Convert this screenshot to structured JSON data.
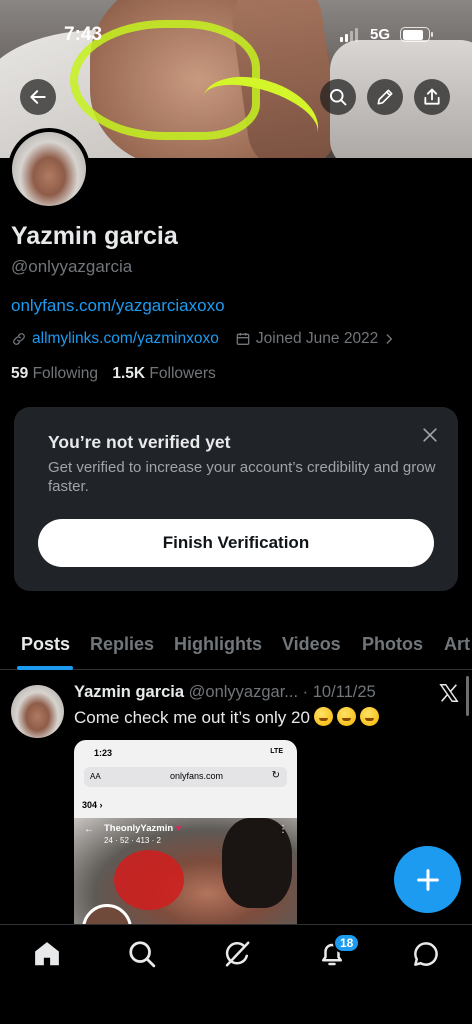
{
  "status_bar": {
    "time": "7:43",
    "network": "5G"
  },
  "profile": {
    "name": "Yazmin garcia",
    "handle": "@onlyyazgarcia",
    "bio_link": "onlyfans.com/yazgarciaxoxo",
    "website": "allmylinks.com/yazminxoxo",
    "joined": "Joined June 2022",
    "following_count": "59",
    "following_label": "Following",
    "followers_count": "1.5K",
    "followers_label": "Followers"
  },
  "verification_card": {
    "title": "You’re not verified yet",
    "description": "Get verified to increase your account’s credibility and grow faster.",
    "button_label": "Finish Verification"
  },
  "tabs": [
    "Posts",
    "Replies",
    "Highlights",
    "Videos",
    "Photos",
    "Art"
  ],
  "active_tab": "Posts",
  "post": {
    "author": "Yazmin garcia",
    "handle": "@onlyyazgar...",
    "date": "· 10/11/25",
    "text": "Come check me out it’s only 20",
    "media": {
      "time": "1:23",
      "status": "LTE",
      "aa": "AA",
      "url": "onlyfans.com",
      "count": "304 ›",
      "profile_name": "TheonlyYazmin",
      "stats": "24 · 52 · 413 · 2"
    }
  },
  "bottom_nav": {
    "items": [
      "home-icon",
      "search-icon",
      "grok-icon",
      "notifications-icon",
      "messages-icon"
    ],
    "notification_badge": "18"
  },
  "colors": {
    "accent": "#1d9bf0",
    "background": "#000000",
    "card": "#202327",
    "muted": "#71767b"
  }
}
